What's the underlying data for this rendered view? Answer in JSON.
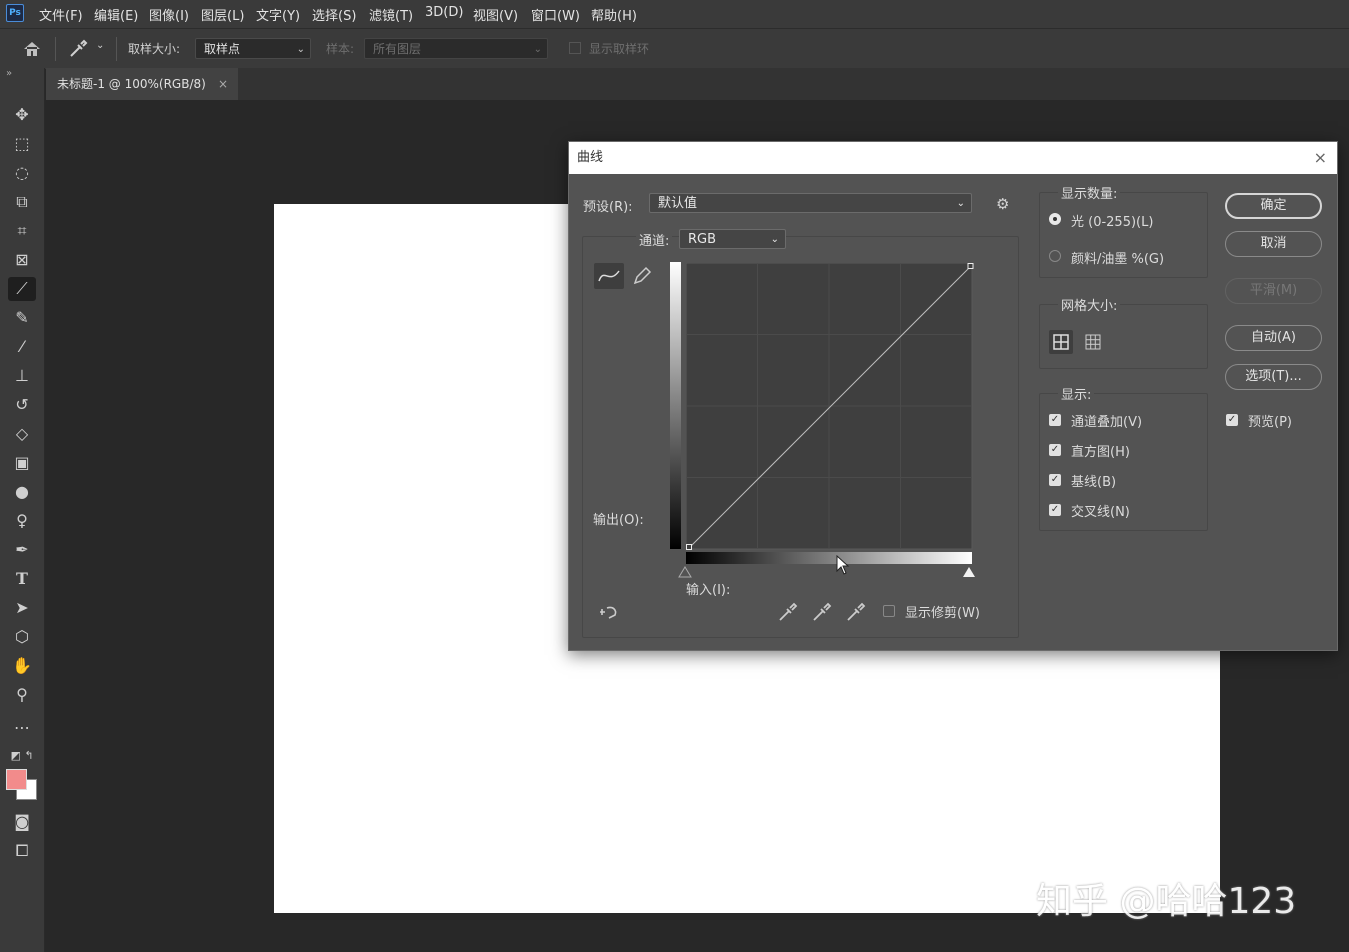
{
  "app": {
    "logo": "Ps"
  },
  "menu": [
    "文件(F)",
    "编辑(E)",
    "图像(I)",
    "图层(L)",
    "文字(Y)",
    "选择(S)",
    "滤镜(T)",
    "3D(D)",
    "视图(V)",
    "窗口(W)",
    "帮助(H)"
  ],
  "options": {
    "sample_size_label": "取样大小:",
    "sample_size_value": "取样点",
    "sample_label": "样本:",
    "sample_value": "所有图层",
    "show_ring_label": "显示取样环"
  },
  "document": {
    "tab_title": "未标题-1 @ 100%(RGB/8)",
    "tab_close": "×"
  },
  "toolbar_expand": "»",
  "colors": {
    "foreground": "#f28b8b",
    "background": "#ffffff"
  },
  "dialog": {
    "title": "曲线",
    "close": "×",
    "preset_label": "预设(R):",
    "preset_value": "默认值",
    "channel_label": "通道:",
    "channel_value": "RGB",
    "output_label": "输出(O):",
    "input_label": "输入(I):",
    "show_clipping_label": "显示修剪(W)",
    "display_amount": {
      "title": "显示数量:",
      "light": "光 (0-255)(L)",
      "pigment": "颜料/油墨 %(G)",
      "selected": "light"
    },
    "grid_size": {
      "title": "网格大小:"
    },
    "show": {
      "title": "显示:",
      "items": [
        {
          "label": "通道叠加(V)",
          "checked": true
        },
        {
          "label": "直方图(H)",
          "checked": true
        },
        {
          "label": "基线(B)",
          "checked": true
        },
        {
          "label": "交叉线(N)",
          "checked": true
        }
      ]
    },
    "buttons": {
      "ok": "确定",
      "cancel": "取消",
      "smooth": "平滑(M)",
      "auto": "自动(A)",
      "options": "选项(T)..."
    },
    "preview_label": "预览(P)",
    "preview_checked": true
  },
  "watermark": "知乎 @哈哈123"
}
